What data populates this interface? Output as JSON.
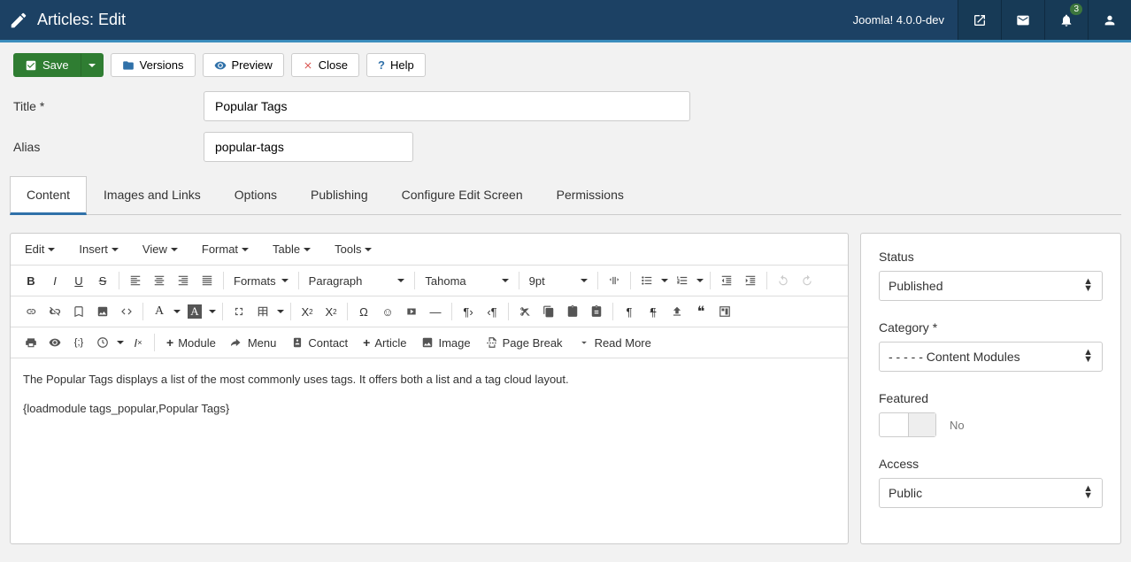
{
  "header": {
    "title": "Articles: Edit",
    "version": "Joomla! 4.0.0-dev",
    "notification_count": "3"
  },
  "toolbar": {
    "save_label": "Save",
    "versions_label": "Versions",
    "preview_label": "Preview",
    "close_label": "Close",
    "help_label": "Help"
  },
  "form": {
    "title_label": "Title *",
    "title_value": "Popular Tags",
    "alias_label": "Alias",
    "alias_value": "popular-tags"
  },
  "tabs": {
    "content": "Content",
    "images": "Images and Links",
    "options": "Options",
    "publishing": "Publishing",
    "configure": "Configure Edit Screen",
    "permissions": "Permissions"
  },
  "editor": {
    "menus": {
      "edit": "Edit",
      "insert": "Insert",
      "view": "View",
      "format": "Format",
      "table": "Table",
      "tools": "Tools"
    },
    "formats_label": "Formats",
    "block_label": "Paragraph",
    "font_label": "Tahoma",
    "size_label": "9pt",
    "buttons": {
      "module": "Module",
      "menu": "Menu",
      "contact": "Contact",
      "article": "Article",
      "image": "Image",
      "page_break": "Page Break",
      "read_more": "Read More"
    },
    "content_line1": "The Popular Tags displays a list of the most commonly uses tags. It offers both a list and a tag cloud layout.",
    "content_line2": "{loadmodule tags_popular,Popular Tags}"
  },
  "sidebar": {
    "status_label": "Status",
    "status_value": "Published",
    "category_label": "Category *",
    "category_value": "- - - - - Content Modules",
    "featured_label": "Featured",
    "featured_value": "No",
    "access_label": "Access",
    "access_value": "Public"
  }
}
